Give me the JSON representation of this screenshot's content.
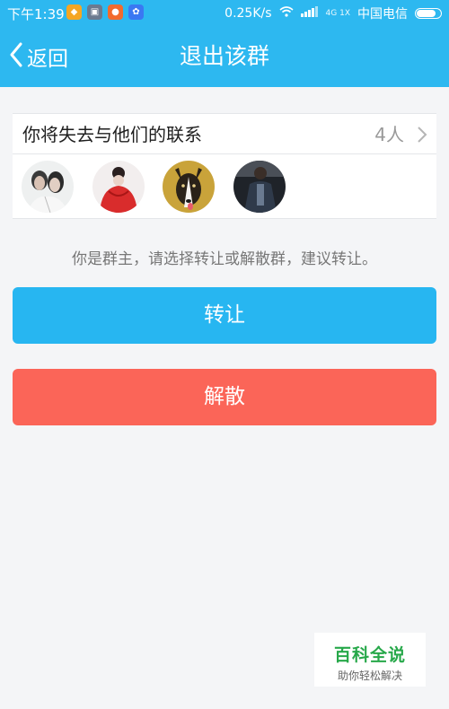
{
  "status_bar": {
    "time": "下午1:39",
    "apps": [
      {
        "name": "app-icon-1",
        "color": "#f5a623"
      },
      {
        "name": "app-icon-2",
        "color": "#6b7a8f"
      },
      {
        "name": "app-icon-3",
        "color": "#f26b2d"
      },
      {
        "name": "app-icon-4",
        "color": "#3a78f2"
      }
    ],
    "network_speed": "0.25K/s",
    "network_type": "4G 1X",
    "carrier": "中国电信",
    "battery_level": 0.75
  },
  "navbar": {
    "back_label": "返回",
    "title": "退出该群"
  },
  "contact_row": {
    "label": "你将失去与他们的联系",
    "count": "4人"
  },
  "members": [
    {
      "name": "member-avatar-1",
      "tone": "#9aa3a6"
    },
    {
      "name": "member-avatar-2",
      "tone": "#d63030"
    },
    {
      "name": "member-avatar-3",
      "tone": "#c9a33a"
    },
    {
      "name": "member-avatar-4",
      "tone": "#2e3440"
    }
  ],
  "hint": "你是群主，请选择转让或解散群，建议转让。",
  "buttons": {
    "transfer": "转让",
    "dissolve": "解散"
  },
  "watermark": {
    "title": "百科全说",
    "subtitle": "助你轻松解决"
  },
  "colors": {
    "header": "#2db8f0",
    "transfer_button": "#27b6f1",
    "dissolve_button": "#fb6558",
    "background": "#f4f5f7"
  }
}
